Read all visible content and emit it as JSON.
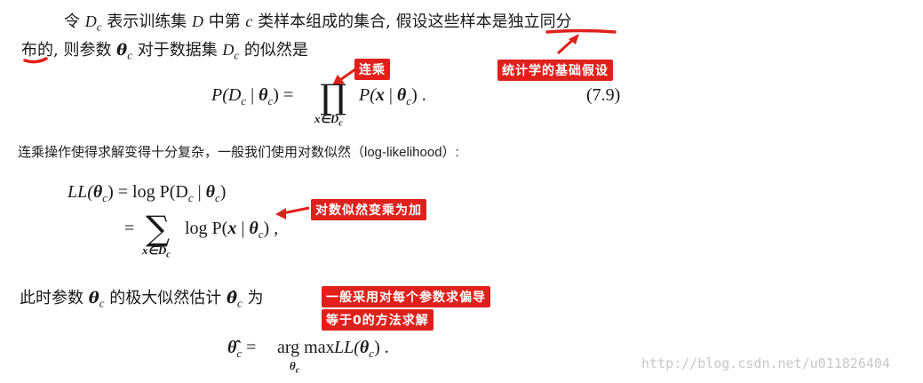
{
  "paragraph1": {
    "line1": {
      "pre": "令 ",
      "d": "D",
      "d_sub": "c",
      "mid": " 表示训练集 ",
      "d2": "D",
      "mid2": " 中第 ",
      "c": "c",
      "post": " 类样本组成的集合, 假设这些样本是",
      "highlight": "独立同分"
    },
    "line2": {
      "highlight": "布",
      "pre": "的, 则参数 ",
      "theta": "θ",
      "theta_sub": "c",
      "mid": " 对于数据集 ",
      "d": "D",
      "d_sub": "c",
      "post": " 的似然是"
    }
  },
  "equation1": {
    "lhs": "P(D",
    "lhs_sub": "c",
    "lhs_bar": " | ",
    "lhs_theta": "θ",
    "lhs_theta_sub": "c",
    "lhs_close": ") =",
    "operator": "∏",
    "operator_under": "x∈D",
    "operator_under_sub": "c",
    "rhs": "P(",
    "rhs_x": "x",
    "rhs_bar": " | ",
    "rhs_theta": "θ",
    "rhs_theta_sub": "c",
    "rhs_close": ") .",
    "number": "(7.9)"
  },
  "annotations": {
    "product": "连乘",
    "iid": "统计学的基础假设",
    "log_sum": "对数似然变乘为加",
    "derivative_line1": "一般采用对每个参数求偏导",
    "derivative_line2": "等于0的方法求解"
  },
  "note_line": "连乘操作使得求解变得十分复杂，一般我们使用对数似然（log-likelihood）:",
  "equation2": {
    "line1_lhs": "LL(",
    "line1_theta": "θ",
    "line1_theta_sub": "c",
    "line1_mid": ") = log  P(D",
    "line1_d_sub": "c",
    "line1_bar": " | ",
    "line1_theta2": "θ",
    "line1_theta2_sub": "c",
    "line1_close": ")",
    "line2_eq": "=",
    "line2_operator": "∑",
    "line2_under": "x∈D",
    "line2_under_sub": "c",
    "line2_rhs": "log P(",
    "line2_x": "x",
    "line2_bar": " | ",
    "line2_theta": "θ",
    "line2_theta_sub": "c",
    "line2_close": ") ,"
  },
  "paragraph2": {
    "pre": "此时参数 ",
    "theta": "θ",
    "theta_sub": "c",
    "mid": " 的极大似然估计 ",
    "theta_hat": "θ̂",
    "theta_hat_sub": "c",
    "post": " 为"
  },
  "equation3": {
    "lhs": "θ̂",
    "lhs_sub": "c",
    "eq": " = ",
    "argmax": "arg max",
    "argmax_under": "θ",
    "argmax_under_sub": "c",
    "rhs": " LL(",
    "rhs_theta": "θ",
    "rhs_theta_sub": "c",
    "rhs_close": ") ."
  },
  "watermark": "http://blog.csdn.net/u011826404",
  "colors": {
    "annotation_red": "#e0201b",
    "text": "#1a1a1a",
    "watermark": "#c8c8c8"
  }
}
